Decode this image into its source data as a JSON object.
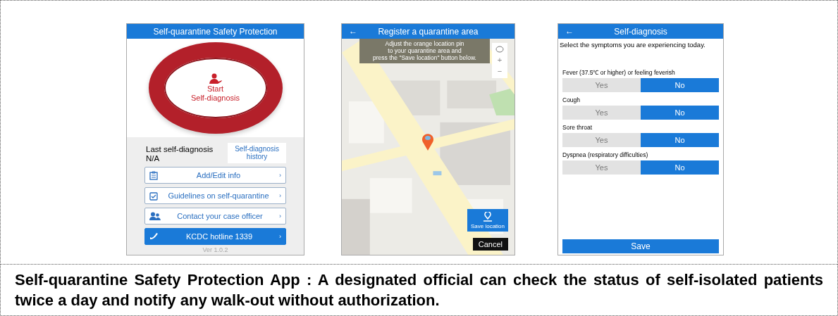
{
  "home_screen": {
    "title": "Self-quarantine Safety Protection",
    "start_button": [
      "Start",
      "Self-diagnosis"
    ],
    "last_diagnosis_label": "Last self-diagnosis",
    "last_diagnosis_value": "N/A",
    "history_button": [
      "Self-diagnosis",
      "history"
    ],
    "menu": [
      {
        "kind": "info",
        "label": "Add/Edit info",
        "arrow": "›"
      },
      {
        "kind": "guide",
        "label": "Guidelines on self-quarantine",
        "arrow": "›"
      },
      {
        "kind": "contact",
        "label": "Contact your case officer",
        "arrow": "›"
      },
      {
        "kind": "hotline",
        "label": "KCDC hotline 1339",
        "arrow": "›"
      }
    ],
    "version": "Ver 1.0.2"
  },
  "map_screen": {
    "back": "←",
    "title": "Register a quarantine area",
    "instruction": [
      "Adjust the orange location pin",
      "to your quarantine area and",
      "press the \"Save location\" button below."
    ],
    "zoom_in": "+",
    "zoom_out": "−",
    "save_button": "Save location",
    "cancel_button": "Cancel"
  },
  "diagnosis_screen": {
    "back": "←",
    "title": "Self-diagnosis",
    "prompt": "Select the symptoms you are experiencing today.",
    "symptoms": [
      {
        "label": "Fever (37.5℃ or higher) or feeling feverish",
        "options": [
          {
            "label": "Yes",
            "selected": false
          },
          {
            "label": "No",
            "selected": true
          }
        ]
      },
      {
        "label": "Cough",
        "options": [
          {
            "label": "Yes",
            "selected": false
          },
          {
            "label": "No",
            "selected": true
          }
        ]
      },
      {
        "label": "Sore throat",
        "options": [
          {
            "label": "Yes",
            "selected": false
          },
          {
            "label": "No",
            "selected": true
          }
        ]
      },
      {
        "label": "Dyspnea (respiratory difficulties)",
        "options": [
          {
            "label": "Yes",
            "selected": false
          },
          {
            "label": "No",
            "selected": true
          }
        ]
      }
    ],
    "save_button": "Save"
  },
  "caption": "Self-quarantine Safety Protection App : A designated official can check the status of self-isolated patients twice a day and notify any walk-out without authorization."
}
